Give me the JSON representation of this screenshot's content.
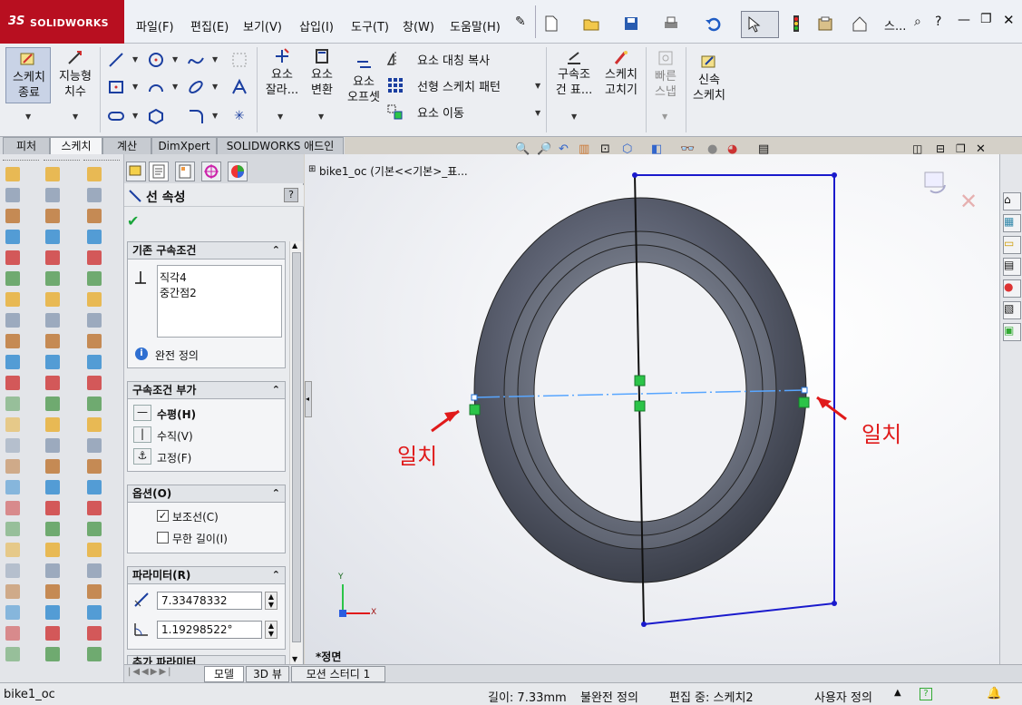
{
  "app": {
    "brand": "SOLIDWORKS",
    "ds_mark": "3S"
  },
  "menu": {
    "items": [
      "파일(F)",
      "편집(E)",
      "보기(V)",
      "삽입(I)",
      "도구(T)",
      "창(W)",
      "도움말(H)"
    ],
    "search_placeholder": "스..."
  },
  "commands": {
    "sketch_exit": "스케치\n종료",
    "smart_dim": "지능형\n치수",
    "trim": "요소\n잘라...",
    "convert": "요소\n변환",
    "offset": "요소\n오프셋",
    "mirror": "요소 대칭 복사",
    "linear_pattern": "선형 스케치 패턴",
    "move": "요소 이동",
    "relations": "구속조\n건 표...",
    "repair": "스케치\n고치기",
    "quick_snap": "빠른\n스냅",
    "rapid_sketch": "신속\n스케치"
  },
  "tabs": [
    "피처",
    "스케치",
    "계산",
    "DimXpert",
    "SOLIDWORKS 애드인"
  ],
  "active_tab": "스케치",
  "property_manager": {
    "title": "선 속성",
    "help": "?",
    "existing_relations": {
      "header": "기존 구속조건",
      "items": [
        "직각4",
        "중간점2"
      ],
      "status": "완전 정의"
    },
    "add_relations": {
      "header": "구속조건 부가",
      "items": [
        {
          "label": "수평(H)",
          "bold": true
        },
        {
          "label": "수직(V)",
          "bold": false
        },
        {
          "label": "고정(F)",
          "bold": false
        }
      ]
    },
    "options": {
      "header": "옵션(O)",
      "construction": {
        "label": "보조선(C)",
        "checked": true
      },
      "infinite": {
        "label": "무한 길이(I)",
        "checked": false
      }
    },
    "parameters": {
      "header": "파라미터(R)",
      "length": "7.33478332",
      "angle": "1.19298522°"
    },
    "extra_params_header": "추가 파라미터"
  },
  "graphics": {
    "tree_label": "bike1_oc (기본<<기본>_표...",
    "view_label": "*정면",
    "annotation_left": "일치",
    "annotation_right": "일치",
    "triad_x": "X",
    "triad_y": "Y"
  },
  "bottom_tabs": [
    "모델",
    "3D 뷰",
    "모션 스터디 1"
  ],
  "status": {
    "file": "bike1_oc",
    "length": "길이: 7.33mm",
    "definition": "불완전 정의",
    "editing": "편집 중: 스케치2",
    "units": "사용자 정의"
  },
  "colors": {
    "brand_red": "#b80f20",
    "annotation_red": "#e01a1a",
    "sketch_blue": "#1a1acc",
    "constraint_green": "#2bc448"
  }
}
